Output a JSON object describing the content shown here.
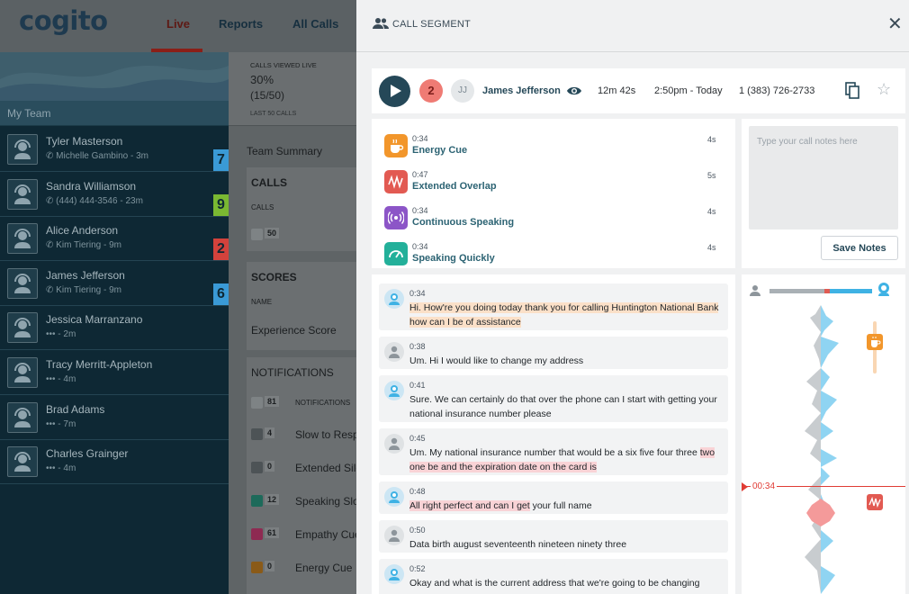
{
  "app": {
    "logo": "cogito",
    "nav": [
      {
        "label": "Live",
        "active": true
      },
      {
        "label": "Reports",
        "active": false
      },
      {
        "label": "All Calls",
        "active": false
      }
    ]
  },
  "sidebar": {
    "header": "My Team",
    "agents": [
      {
        "name": "Tyler Masterson",
        "sub": "Michelle Gambino - 3m",
        "sub_icon": "phone-icon",
        "badge": "7",
        "badge_color": "#3a9ad6"
      },
      {
        "name": "Sandra Williamson",
        "sub": "(444) 444-3546  - 23m",
        "sub_icon": "phone-icon",
        "badge": "9",
        "badge_color": "#7ab832"
      },
      {
        "name": "Alice Anderson",
        "sub": "Kim Tiering - 9m",
        "sub_icon": "phone-icon",
        "badge": "2",
        "badge_color": "#d3423c"
      },
      {
        "name": "James Jefferson",
        "sub": "Kim Tiering - 9m",
        "sub_icon": "phone-icon",
        "badge": "6",
        "badge_color": "#3a9ad6"
      },
      {
        "name": "Jessica Marranzano",
        "sub": "- 2m",
        "sub_icon": "dots-icon",
        "badge": "",
        "badge_color": ""
      },
      {
        "name": "Tracy Merritt-Appleton",
        "sub": "- 4m",
        "sub_icon": "dots-icon",
        "badge": "",
        "badge_color": ""
      },
      {
        "name": "Brad Adams",
        "sub": "- 7m",
        "sub_icon": "dots-icon",
        "badge": "",
        "badge_color": ""
      },
      {
        "name": "Charles Grainger",
        "sub": "- 4m",
        "sub_icon": "dots-icon",
        "badge": "",
        "badge_color": ""
      }
    ]
  },
  "dashboard": {
    "stat": {
      "caption": "CALLS VIEWED LIVE",
      "value": "30%",
      "sub": "(15/50)",
      "last": "LAST 50 CALLS"
    },
    "team_summary": "Team Summary",
    "calls": {
      "title": "CALLS",
      "label": "CALLS",
      "count": "50"
    },
    "scores": {
      "title": "SCORES",
      "name_label": "NAME",
      "row": "Experience Score"
    },
    "notifications": {
      "title": "NOTIFICATIONS",
      "header_count": "81",
      "header_label": "NOTIFICATIONS",
      "rows": [
        {
          "count": "4",
          "label": "Slow to Respon",
          "color": "#4d5356"
        },
        {
          "count": "0",
          "label": "Extended Silen",
          "color": "#4d5356"
        },
        {
          "count": "12",
          "label": "Speaking Slow",
          "color": "#1d6a5a"
        },
        {
          "count": "61",
          "label": "Empathy Cue",
          "color": "#8e2a52"
        },
        {
          "count": "0",
          "label": "Energy Cue",
          "color": "#8a5a18"
        }
      ]
    }
  },
  "panel": {
    "title": "CALL SEGMENT",
    "call": {
      "count": "2",
      "initials": "JJ",
      "name": "James Jefferson",
      "duration": "12m 42s",
      "time": "2:50pm - Today",
      "phone": "1 (383) 726-2733"
    },
    "events": [
      {
        "time": "0:34",
        "name": "Energy Cue",
        "dur": "4s",
        "color": "#f2962b",
        "icon": "coffee-icon"
      },
      {
        "time": "0:47",
        "name": "Extended Overlap",
        "dur": "5s",
        "color": "#e25a52",
        "icon": "overlap-icon"
      },
      {
        "time": "0:34",
        "name": "Continuous Speaking",
        "dur": "4s",
        "color": "#8c55c7",
        "icon": "speaking-icon"
      },
      {
        "time": "0:34",
        "name": "Speaking Quickly",
        "dur": "4s",
        "color": "#23b09a",
        "icon": "speedometer-icon"
      }
    ],
    "notes": {
      "placeholder": "Type your call notes here",
      "save": "Save Notes"
    },
    "transcript": [
      {
        "speaker": "agent",
        "time": "0:34",
        "parts": [
          {
            "t": "Hi. How're you doing today thank you for calling Huntington National Bank how can I be of assistance",
            "hl": "o"
          }
        ]
      },
      {
        "speaker": "customer",
        "time": "0:38",
        "parts": [
          {
            "t": "Um. Hi I would like to change my address",
            "hl": ""
          }
        ]
      },
      {
        "speaker": "agent",
        "time": "0:41",
        "parts": [
          {
            "t": "Sure. We can certainly do that over the phone can I start with getting your national insurance number please",
            "hl": ""
          }
        ]
      },
      {
        "speaker": "customer",
        "time": "0:45",
        "parts": [
          {
            "t": "Um. My national insurance number that would be a six five four three ",
            "hl": ""
          },
          {
            "t": "two one be and the expiration date on the card is",
            "hl": "p"
          }
        ]
      },
      {
        "speaker": "agent",
        "time": "0:48",
        "parts": [
          {
            "t": "All right perfect and can I get",
            "hl": "p"
          },
          {
            "t": " your full name",
            "hl": ""
          }
        ]
      },
      {
        "speaker": "customer",
        "time": "0:50",
        "parts": [
          {
            "t": "Data birth august seventeenth nineteen ninety three",
            "hl": ""
          }
        ]
      },
      {
        "speaker": "agent",
        "time": "0:52",
        "parts": [
          {
            "t": "Okay and what is the current address that we're going to be changing",
            "hl": ""
          }
        ]
      }
    ],
    "timeline": {
      "cursor": "00:34"
    }
  }
}
